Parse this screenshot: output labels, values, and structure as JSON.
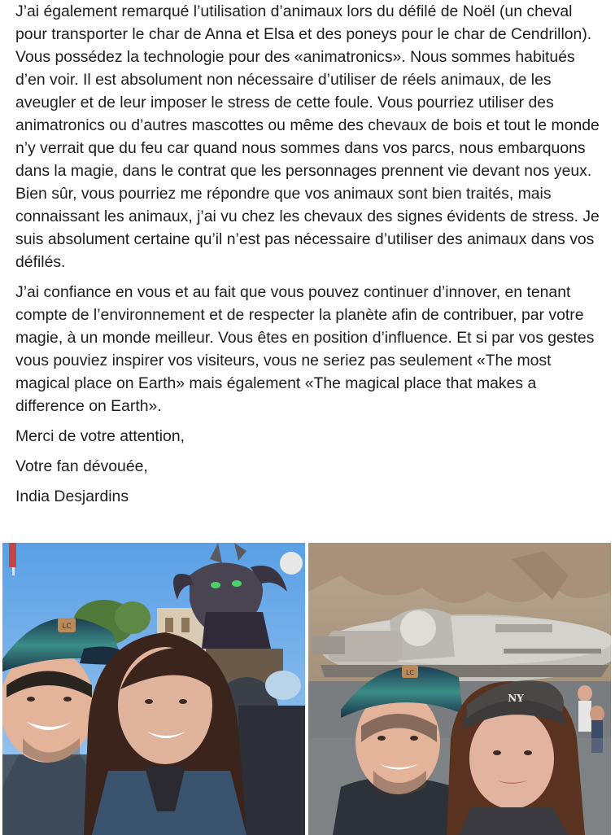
{
  "post": {
    "paragraphs": [
      "J’ai également remarqué l’utilisation d’animaux lors du défilé de Noël (un cheval pour transporter le char de Anna et Elsa et des poneys pour le char de Cendrillon). Vous possédez la technologie pour des «animatronics». Nous sommes habitués d’en voir. Il est absolument non nécessaire d’utiliser de réels animaux, de les aveugler et de leur imposer le stress de cette foule. Vous pourriez utiliser des animatronics ou d’autres mascottes ou même des chevaux de bois et tout le monde n’y verrait que du feu car quand nous sommes dans vos parcs, nous embarquons dans la magie, dans le contrat que les personnages prennent vie devant nos yeux. Bien sûr, vous pourriez me répondre que vos animaux sont bien traités, mais connaissant les animaux, j’ai vu chez les chevaux des signes évidents de stress. Je suis absolument certaine qu’il n’est pas nécessaire d’utiliser des animaux dans vos défilés.",
      "J’ai confiance en vous et au fait que vous pouvez continuer d’innover, en tenant compte de l’environnement et de respecter la planète afin de contribuer, par votre magie, à un monde meilleur. Vous êtes en position d’influence. Et si par vos gestes vous pouviez inspirer vos visiteurs, vous ne seriez pas seulement «The most magical place on Earth» mais également «The magical place that makes a difference on Earth».",
      "Merci de votre attention,",
      "Votre fan dévouée,",
      "India Desjardins"
    ]
  },
  "photos": [
    {
      "name": "selfie-parade-dragon",
      "cap_logo": "LC"
    },
    {
      "name": "selfie-millennium-falcon",
      "cap_logo": "LC",
      "cap2_logo": "NY"
    }
  ]
}
